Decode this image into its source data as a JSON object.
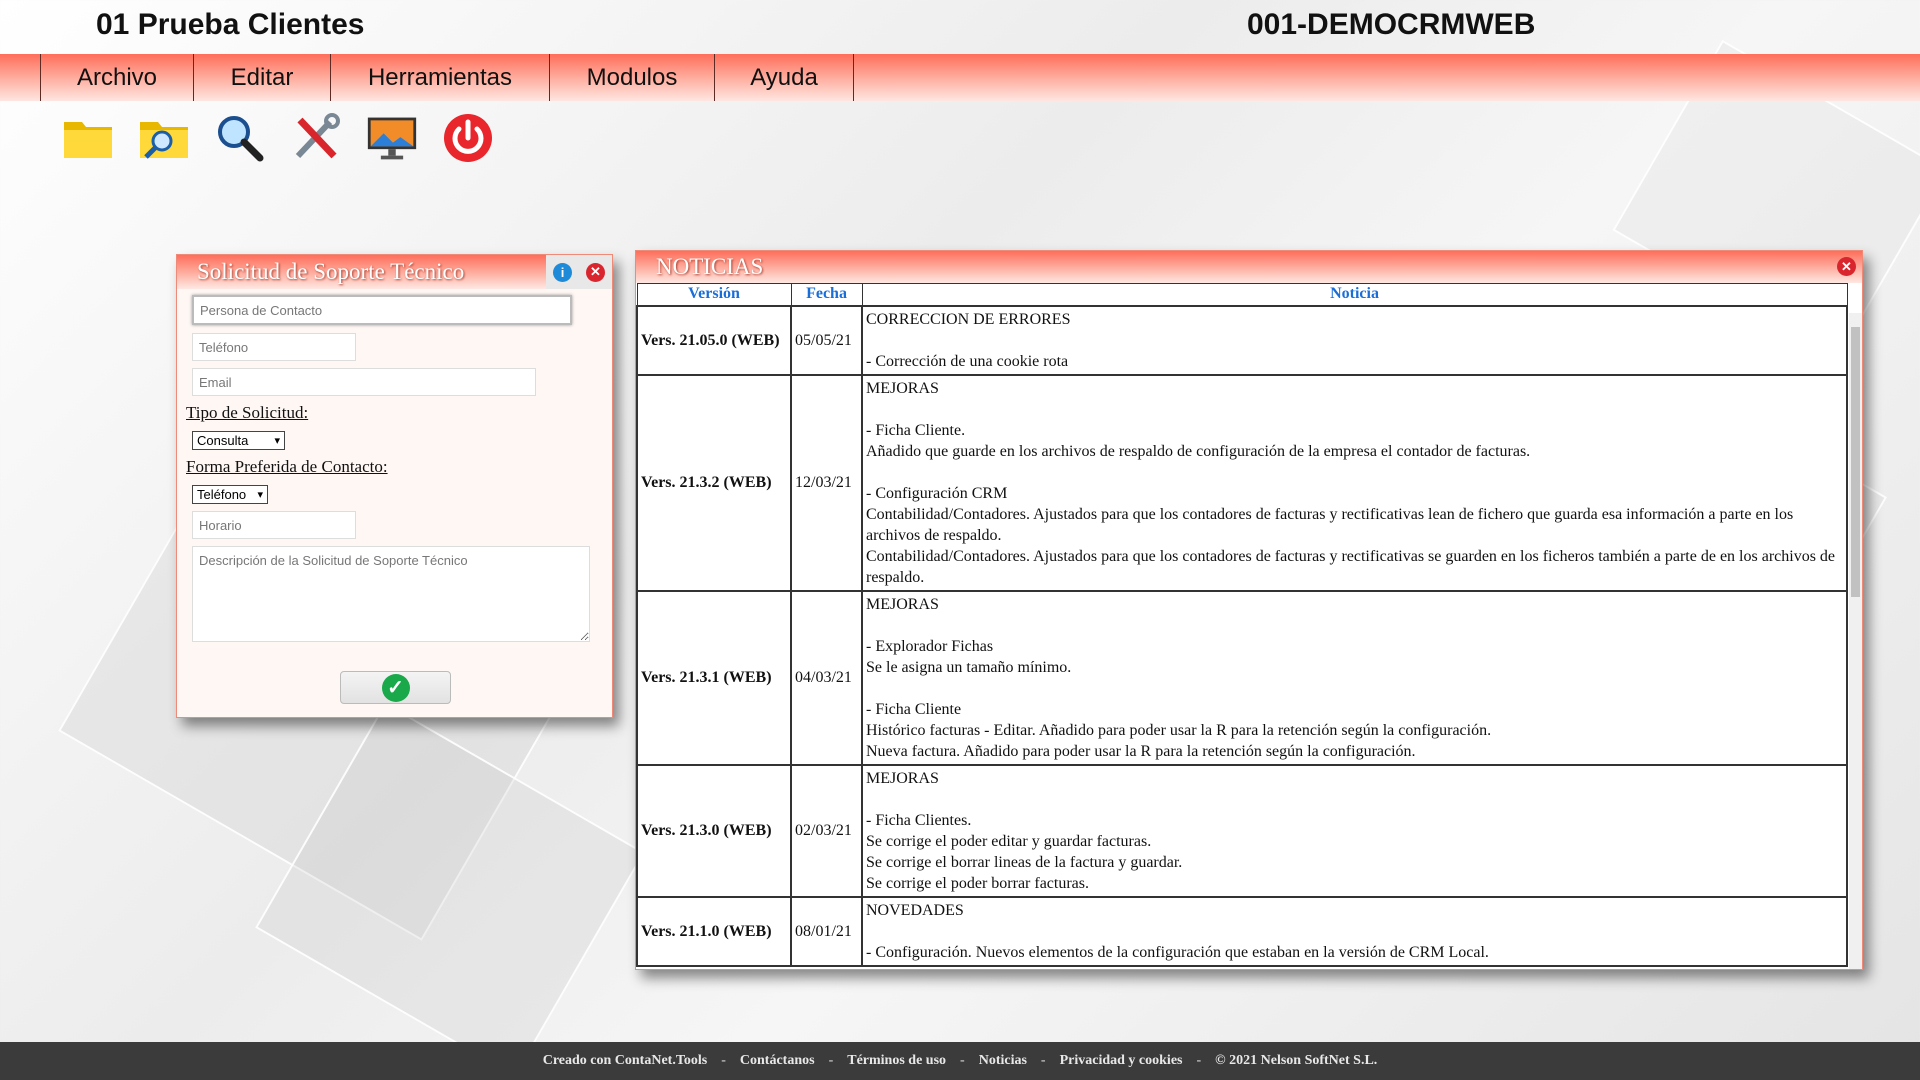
{
  "header": {
    "app_title": "01 Prueba Clientes",
    "db_title": "001-DEMOCRMWEB"
  },
  "menu": [
    "Archivo",
    "Editar",
    "Herramientas",
    "Modulos",
    "Ayuda"
  ],
  "toolbar": [
    "folder-icon",
    "folder-search-icon",
    "magnifier-icon",
    "tools-icon",
    "monitor-icon",
    "power-icon"
  ],
  "support": {
    "title": "Solicitud de Soporte Técnico",
    "contact_placeholder": "Persona de Contacto",
    "phone_placeholder": "Teléfono",
    "email_placeholder": "Email",
    "type_label": "Tipo de Solicitud:",
    "type_value": "Consulta",
    "contact_pref_label": "Forma Preferida de Contacto:",
    "contact_pref_value": "Teléfono",
    "schedule_placeholder": "Horario",
    "description_placeholder": "Descripción de la Solicitud de Soporte Técnico"
  },
  "news": {
    "title": "NOTICIAS",
    "columns": [
      "Versión",
      "Fecha",
      "Noticia"
    ],
    "rows": [
      {
        "version": "Vers. 21.05.0 (WEB)",
        "date": "05/05/21",
        "lines": [
          "CORRECCION DE ERRORES",
          "",
          "- Corrección de una cookie rota"
        ]
      },
      {
        "version": "Vers. 21.3.2 (WEB)",
        "date": "12/03/21",
        "lines": [
          "MEJORAS",
          "",
          "- Ficha Cliente.",
          "Añadido que guarde en los archivos de respaldo de configuración de la empresa el contador de facturas.",
          "",
          "- Configuración CRM",
          "Contabilidad/Contadores. Ajustados para que los contadores de facturas y rectificativas lean de fichero que guarda esa información a parte en los archivos de respaldo.",
          "Contabilidad/Contadores. Ajustados para que los contadores de facturas y rectificativas se guarden en los ficheros también a parte de en los archivos de respaldo."
        ]
      },
      {
        "version": "Vers. 21.3.1 (WEB)",
        "date": "04/03/21",
        "lines": [
          "MEJORAS",
          "",
          "- Explorador Fichas",
          "Se le asigna un tamaño mínimo.",
          "",
          "- Ficha Cliente",
          "Histórico facturas - Editar. Añadido para poder usar la R para la retención según la configuración.",
          "Nueva factura. Añadido para poder usar la R para la retención según la configuración."
        ]
      },
      {
        "version": "Vers. 21.3.0 (WEB)",
        "date": "02/03/21",
        "lines": [
          "MEJORAS",
          "",
          "- Ficha Clientes.",
          "Se corrige el poder editar y guardar facturas.",
          "Se corrige el borrar lineas de la factura y guardar.",
          "Se corrige el poder borrar facturas."
        ]
      },
      {
        "version": "Vers. 21.1.0 (WEB)",
        "date": "08/01/21",
        "lines": [
          "NOVEDADES",
          "",
          "- Configuración. Nuevos elementos de la configuración que estaban en la versión de CRM Local."
        ]
      }
    ]
  },
  "footer": [
    "Creado con ContaNet.Tools",
    "Contáctanos",
    "Términos de uso",
    "Noticias",
    "Privacidad y cookies",
    "© 2021 Nelson SoftNet S.L."
  ],
  "colors": {
    "accent": "#ff6e5a",
    "link_blue": "#1a6ed8",
    "ok_green": "#19a84a",
    "close_red": "#d9262e"
  }
}
